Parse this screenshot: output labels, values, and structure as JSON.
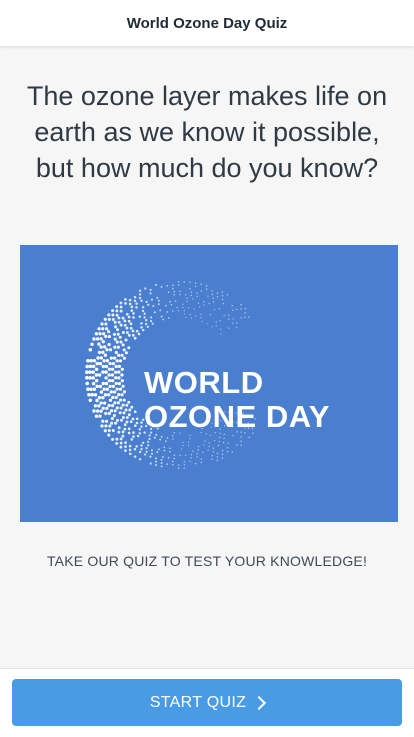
{
  "header": {
    "title": "World Ozone Day Quiz"
  },
  "main": {
    "headline": "The ozone layer makes life on earth as we know it possible, but how much do you know?",
    "hero": {
      "line1": "WORLD",
      "line2": "OZONE DAY",
      "background": "#4a7fd0"
    },
    "subtitle": "TAKE OUR QUIZ TO TEST YOUR KNOWLEDGE!"
  },
  "footer": {
    "start_label": "START QUIZ",
    "button_color": "#4a9be6",
    "icon": "chevron-right-icon"
  }
}
